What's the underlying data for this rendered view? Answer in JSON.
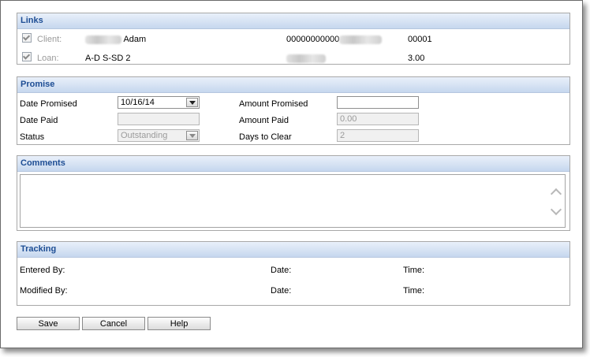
{
  "links": {
    "title": "Links",
    "client": {
      "label": "Client:",
      "name": "Adam",
      "account_number": "00000000000",
      "id": "00001"
    },
    "loan": {
      "label": "Loan:",
      "name": "A-D  S-SD  2",
      "amount": "3.00"
    }
  },
  "promise": {
    "title": "Promise",
    "date_promised_label": "Date Promised",
    "date_promised_value": "10/16/14",
    "date_paid_label": "Date Paid",
    "date_paid_value": "",
    "status_label": "Status",
    "status_value": "Outstanding",
    "amount_promised_label": "Amount Promised",
    "amount_promised_value": "",
    "amount_paid_label": "Amount Paid",
    "amount_paid_value": "0.00",
    "days_to_clear_label": "Days to Clear",
    "days_to_clear_value": "2"
  },
  "comments": {
    "title": "Comments",
    "value": ""
  },
  "tracking": {
    "title": "Tracking",
    "entered_by_label": "Entered By:",
    "modified_by_label": "Modified By:",
    "date_label": "Date:",
    "time_label": "Time:"
  },
  "buttons": {
    "save": "Save",
    "cancel": "Cancel",
    "help": "Help"
  },
  "icons": {
    "checkbox": "checkmark-icon",
    "dropdown": "chevron-down-icon",
    "scroll_up": "scroll-up-icon",
    "scroll_down": "scroll-down-icon"
  },
  "colors": {
    "section_header_text": "#1d4d94",
    "section_header_bg": "#c6d7ee"
  }
}
